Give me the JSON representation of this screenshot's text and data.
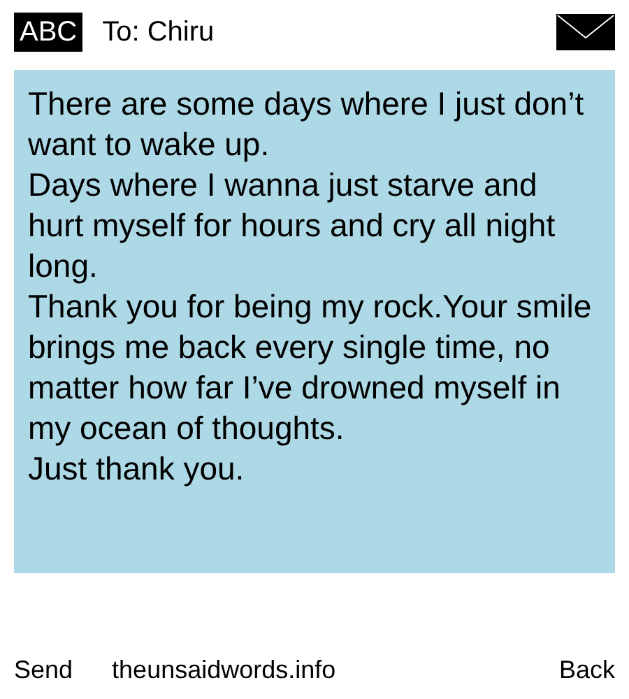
{
  "header": {
    "input_mode": "ABC",
    "recipient": "To: Chiru"
  },
  "message": {
    "paragraphs": [
      "There are some days where I just don’t want to wake up.",
      "Days where I wanna just starve and hurt myself for hours and cry all night long.",
      "Thank you for being my rock.Your smile brings me back every single time, no matter how far I’ve drowned myself in my ocean of thoughts.",
      "Just thank you."
    ]
  },
  "footer": {
    "left": "Send",
    "center": "theunsaidwords.info",
    "right": "Back"
  }
}
